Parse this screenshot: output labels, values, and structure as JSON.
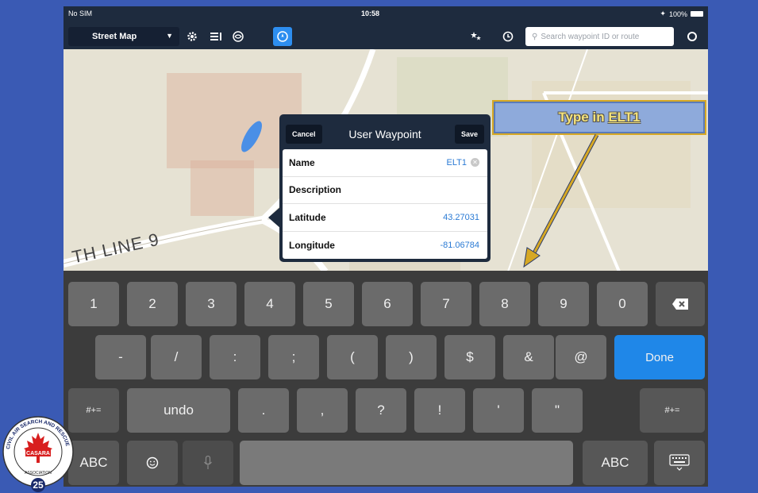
{
  "status_bar": {
    "carrier": "No SIM",
    "time": "10:58",
    "battery": "100%"
  },
  "toolbar": {
    "map_type": "Street Map",
    "search_placeholder": "Search waypoint ID or route"
  },
  "map": {
    "road_label": "TH LINE 9"
  },
  "popup": {
    "title": "User Waypoint",
    "cancel_label": "Cancel",
    "save_label": "Save",
    "rows": [
      {
        "label": "Name",
        "value": "ELT1"
      },
      {
        "label": "Description",
        "value": ""
      },
      {
        "label": "Latitude",
        "value": "43.27031"
      },
      {
        "label": "Longitude",
        "value": "-81.06784"
      }
    ]
  },
  "callout": {
    "prefix": "Type in ",
    "emphasis": "ELT1"
  },
  "keyboard": {
    "row1": [
      "1",
      "2",
      "3",
      "4",
      "5",
      "6",
      "7",
      "8",
      "9",
      "0"
    ],
    "row2": [
      "-",
      "/",
      ":",
      ";",
      "(",
      ")",
      "$",
      "&",
      "@"
    ],
    "done_label": "Done",
    "row3_left": "#+=",
    "undo_label": "undo",
    "row3": [
      ".",
      ",",
      "?",
      "!",
      "'",
      "\""
    ],
    "row3_right": "#+=",
    "abc_left": "ABC",
    "abc_right": "ABC"
  },
  "logo": {
    "text_top": "CIVIL AIR SEARCH AND RESCUE",
    "text_mid": "CASARA",
    "text_bottom": "ASSOCIATION",
    "number": "25"
  },
  "colors": {
    "background": "#3a5ab4",
    "toolbar": "#1e2b3e",
    "done": "#1f87e8",
    "link": "#2a7ad4"
  }
}
